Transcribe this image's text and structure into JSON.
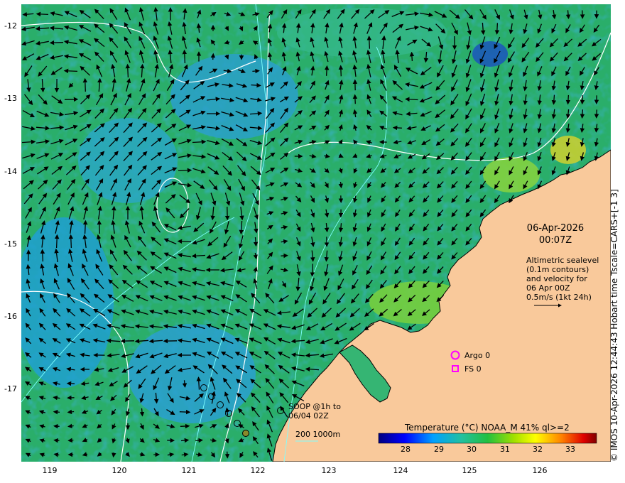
{
  "axes": {
    "x_ticks": [
      "119",
      "120",
      "121",
      "122",
      "123",
      "124",
      "125",
      "126"
    ],
    "y_ticks": [
      "-12",
      "-13",
      "-14",
      "-15",
      "-16",
      "-17"
    ]
  },
  "credit": "© IMOS 10-Apr-2026 12:44:43 Hobart time Tscale=CARS+[-1 3]",
  "timestamp": {
    "date": "06-Apr-2026",
    "time": "00:07Z"
  },
  "description": [
    "Altimetric sealevel",
    "(0.1m contours)",
    "and velocity for",
    "06 Apr 00Z",
    "0.5m/s (1kt 24h)"
  ],
  "legend": {
    "argo": "Argo 0",
    "fs": "FS 0",
    "soop": [
      "SOOP @1h to",
      "06/04 02Z"
    ],
    "isobaths": "200  1000m"
  },
  "colorbar": {
    "title": "Temperature (°C) NOAA_M 41% ql>=2",
    "ticks": [
      "28",
      "29",
      "30",
      "31",
      "32",
      "33"
    ]
  },
  "colors": {
    "land": "#f9c99b",
    "ocean": "#22b573",
    "argo": "#ff00ff",
    "contour": "#ffffff",
    "isobath": "#7fffff"
  }
}
